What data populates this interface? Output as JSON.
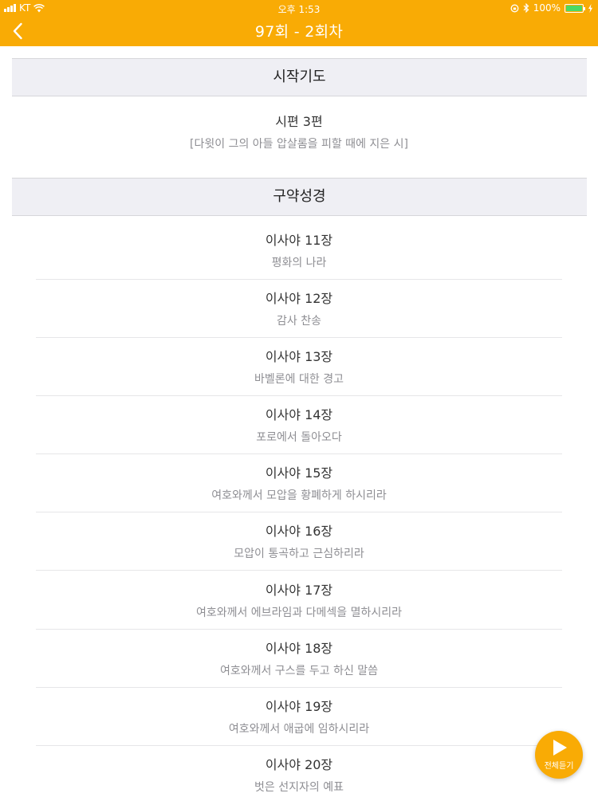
{
  "status_bar": {
    "carrier": "KT",
    "time": "오후 1:53",
    "battery": "100%"
  },
  "nav": {
    "title": "97회 - 2회차"
  },
  "sections": [
    {
      "header": "시작기도",
      "items": [
        {
          "title": "시편 3편",
          "subtitle": "[다윗이 그의 아들 압살롬을 피할 때에 지은 시]"
        }
      ]
    },
    {
      "header": "구약성경",
      "items": [
        {
          "title": "이사야 11장",
          "subtitle": "평화의 나라"
        },
        {
          "title": "이사야 12장",
          "subtitle": "감사 찬송"
        },
        {
          "title": "이사야 13장",
          "subtitle": "바벨론에 대한 경고"
        },
        {
          "title": "이사야 14장",
          "subtitle": "포로에서 돌아오다"
        },
        {
          "title": "이사야 15장",
          "subtitle": "여호와께서 모압을 황폐하게 하시리라"
        },
        {
          "title": "이사야 16장",
          "subtitle": "모압이 통곡하고 근심하리라"
        },
        {
          "title": "이사야 17장",
          "subtitle": "여호와께서 에브라임과 다메섹을 멸하시리라"
        },
        {
          "title": "이사야 18장",
          "subtitle": "여호와께서 구스를 두고 하신 말씀"
        },
        {
          "title": "이사야 19장",
          "subtitle": "여호와께서 애굽에 임하시리라"
        },
        {
          "title": "이사야 20장",
          "subtitle": "벗은 선지자의 예표"
        }
      ]
    }
  ],
  "fab": {
    "label": "전체듣기"
  },
  "colors": {
    "accent": "#f9ab05",
    "section_bg": "#efeff4",
    "subtitle": "#8e8e93"
  },
  "icons": {
    "back": "chevron-left-icon",
    "play": "play-icon"
  }
}
